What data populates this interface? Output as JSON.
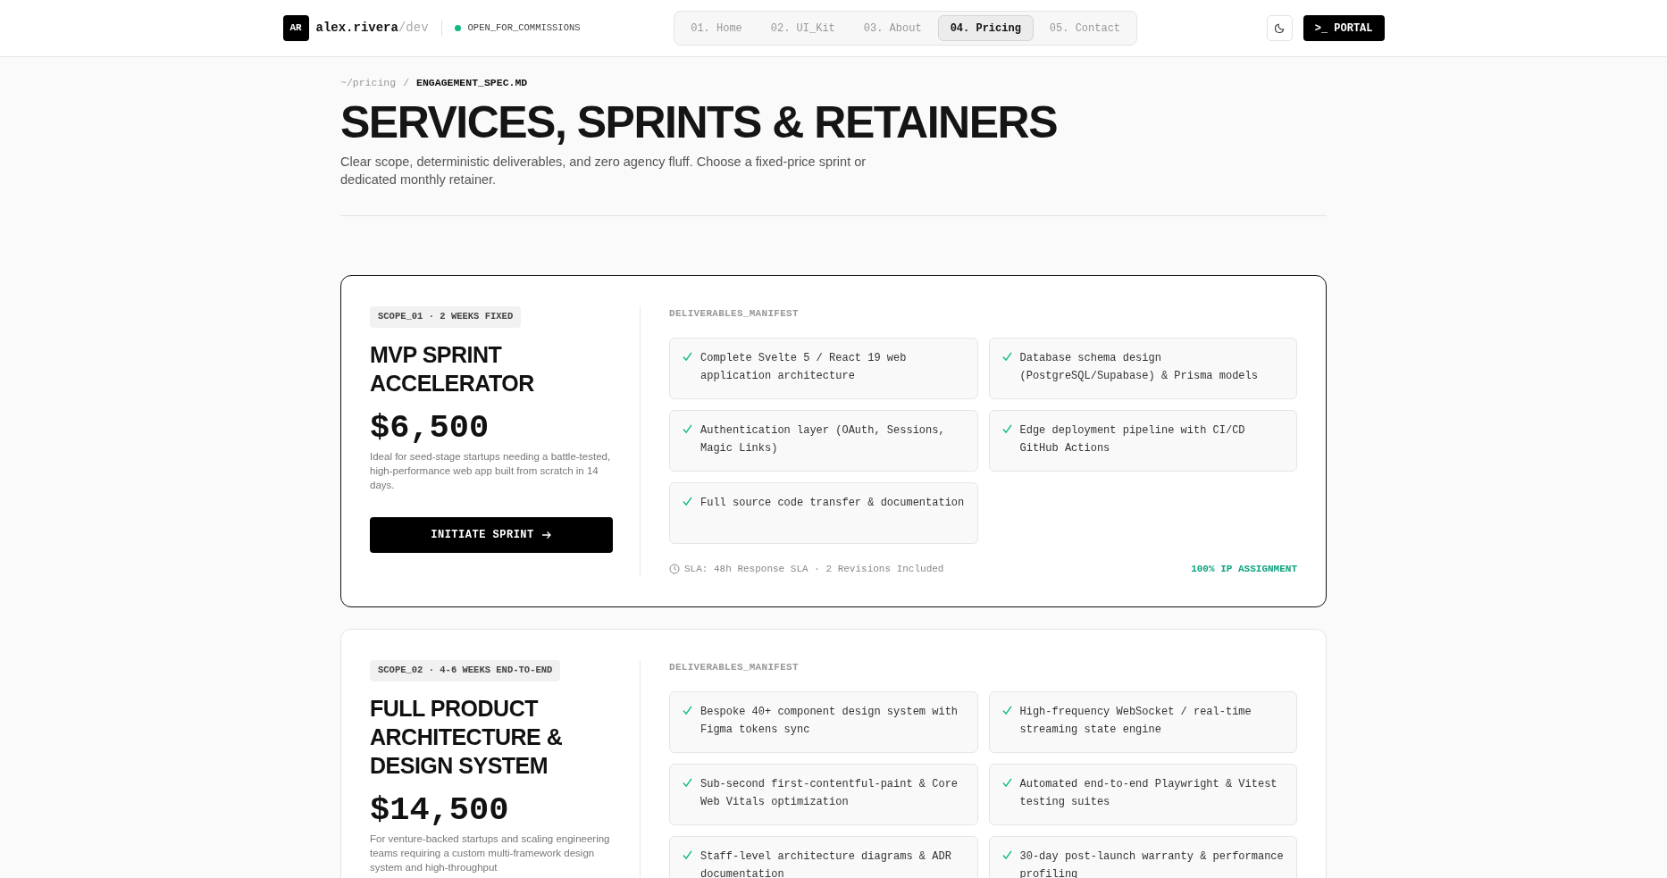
{
  "header": {
    "avatar": "AR",
    "brand": "alex.rivera",
    "brand_suffix": "/dev",
    "status": "OPEN_FOR_COMMISSIONS",
    "nav": [
      {
        "label": "01. Home",
        "selected": false
      },
      {
        "label": "02. UI_Kit",
        "selected": false
      },
      {
        "label": "03. About",
        "selected": false
      },
      {
        "label": "04. Pricing",
        "selected": true
      },
      {
        "label": "05. Contact",
        "selected": false
      }
    ],
    "portal_button": ">_ PORTAL"
  },
  "breadcrumb": {
    "path": "~/pricing",
    "separator": "/",
    "current": "ENGAGEMENT_SPEC.MD"
  },
  "title": "SERVICES, SPRINTS & RETAINERS",
  "subtitle": "Clear scope, deterministic deliverables, and zero agency fluff. Choose a fixed-price sprint or dedicated monthly retainer.",
  "plans": [
    {
      "featured": true,
      "tag": "SCOPE_01 · 2 WEEKS FIXED",
      "name": "MVP SPRINT ACCELERATOR",
      "price": "$6,500",
      "description": "Ideal for seed-stage startups needing a battle-tested, high-performance web app built from scratch in 14 days.",
      "button": "INITIATE SPRINT",
      "manifest_label": "DELIVERABLES_MANIFEST",
      "deliverables": [
        "Complete Svelte 5 / React 19 web application architecture",
        "Database schema design (PostgreSQL/Supabase) & Prisma models",
        "Authentication layer (OAuth, Sessions, Magic Links)",
        "Edge deployment pipeline with CI/CD GitHub Actions",
        "Full source code transfer & documentation"
      ],
      "sla": "SLA: 48h Response SLA · 2 Revisions Included",
      "guarantee": "100% IP ASSIGNMENT"
    },
    {
      "featured": false,
      "tag": "SCOPE_02 · 4-6 WEEKS END-TO-END",
      "name": "FULL PRODUCT ARCHITECTURE & DESIGN SYSTEM",
      "price": "$14,500",
      "description": "For venture-backed startups and scaling engineering teams requiring a custom multi-framework design system and high-throughput",
      "manifest_label": "DELIVERABLES_MANIFEST",
      "deliverables": [
        "Bespoke 40+ component design system with Figma tokens sync",
        "High-frequency WebSocket / real-time streaming state engine",
        "Sub-second first-contentful-paint & Core Web Vitals optimization",
        "Automated end-to-end Playwright & Vitest testing suites",
        "Staff-level architecture diagrams & ADR documentation",
        "30-day post-launch warranty & performance profiling"
      ]
    }
  ]
}
